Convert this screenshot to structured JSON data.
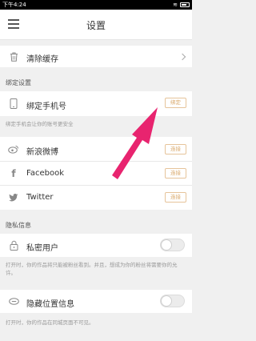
{
  "status_bar": {
    "time": "下午4:24"
  },
  "nav": {
    "title": "设置"
  },
  "clear_cache": {
    "label": "清除缓存"
  },
  "binding_section": {
    "title": "绑定设置",
    "phone": {
      "label": "绑定手机号",
      "button": "绑定"
    },
    "hint": "绑定手机会让你的账号更安全",
    "weibo": {
      "label": "新浪微博",
      "button": "连接"
    },
    "facebook": {
      "label": "Facebook",
      "button": "连接"
    },
    "twitter": {
      "label": "Twitter",
      "button": "连接"
    }
  },
  "privacy_section": {
    "title": "隐私信息",
    "private_user": {
      "label": "私密用户",
      "enabled": false
    },
    "private_hint": "打开时，你的作品将只能被粉丝看到。并且，想成为你的粉丝将需要你的允许。",
    "hide_location": {
      "label": "隐藏位置信息",
      "enabled": false
    },
    "location_hint": "打开时，你的作品在同城页面不可见。"
  },
  "colors": {
    "accent": "#d9a86a",
    "arrow": "#e8246f"
  }
}
